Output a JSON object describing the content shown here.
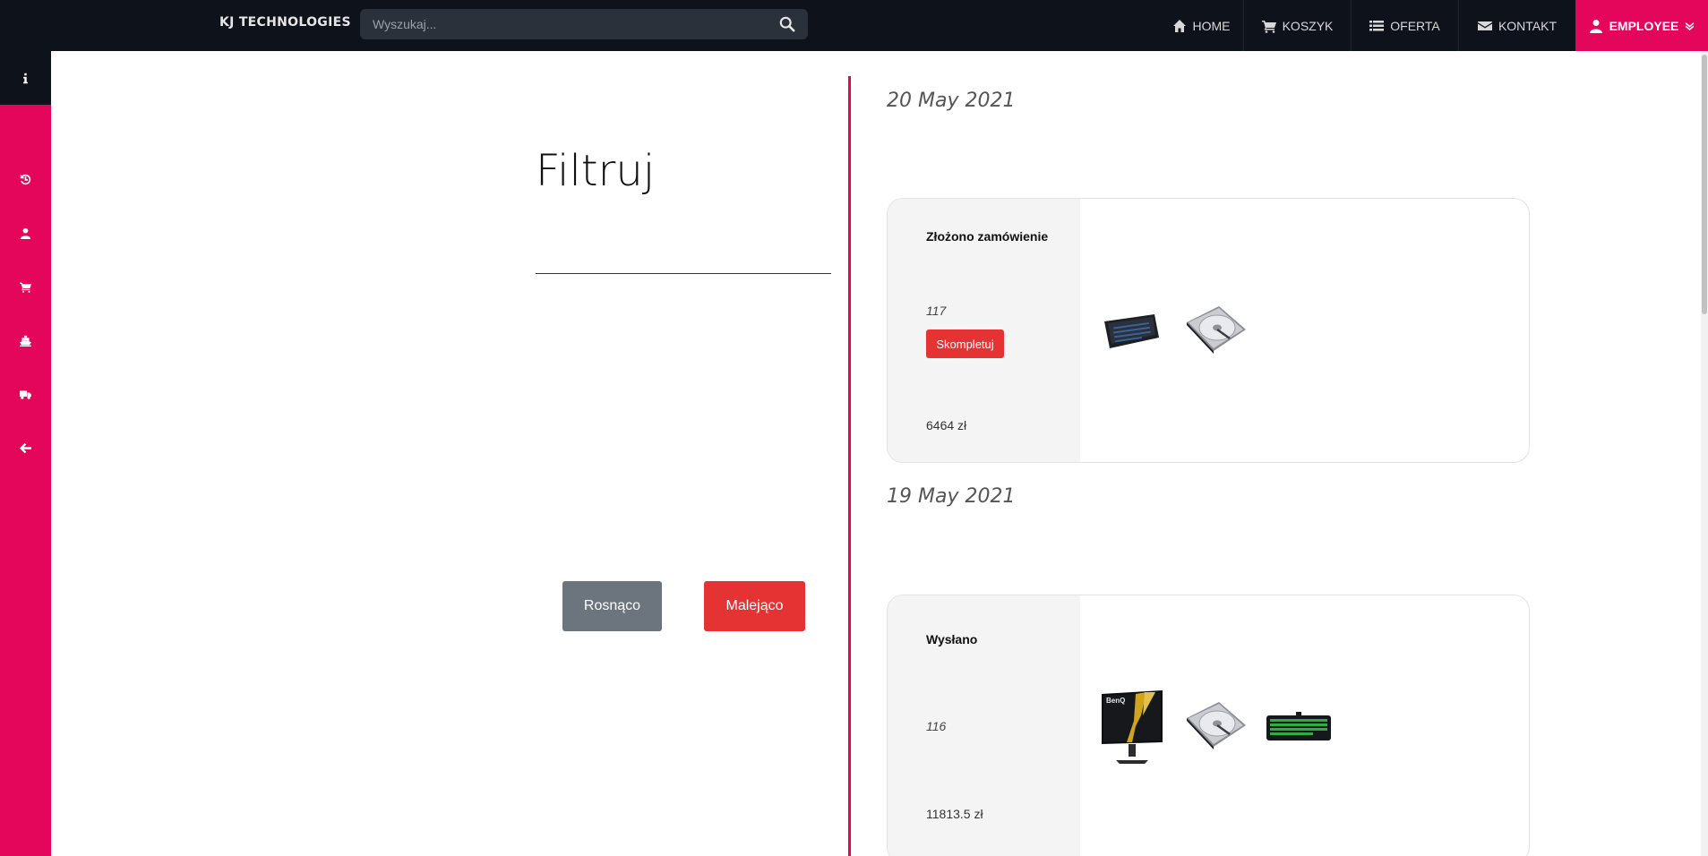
{
  "header": {
    "brand": "KJ TECHNOLOGIES",
    "search_placeholder": "Wyszukaj...",
    "nav": [
      {
        "label": "HOME",
        "icon": "home-icon"
      },
      {
        "label": "KOSZYK",
        "icon": "cart-icon"
      },
      {
        "label": "OFERTA",
        "icon": "list-icon"
      },
      {
        "label": "KONTAKT",
        "icon": "envelope-icon"
      }
    ],
    "user": {
      "label": "EMPLOYEE",
      "icon": "user-icon"
    }
  },
  "sidebar": {
    "items": [
      {
        "icon": "info-icon"
      },
      {
        "icon": "history-icon"
      },
      {
        "icon": "user-icon"
      },
      {
        "icon": "cart-icon"
      },
      {
        "icon": "ship-icon"
      },
      {
        "icon": "truck-icon"
      },
      {
        "icon": "arrow-left-icon"
      }
    ]
  },
  "filter": {
    "title": "Filtruj",
    "input_value": "",
    "asc_label": "Rosnąco",
    "desc_label": "Malejąco"
  },
  "orders": [
    {
      "date": "20 May 2021",
      "status": "Złożono zamówienie",
      "id": "117",
      "action_label": "Skompletuj",
      "price": "6464 zł",
      "products": [
        "keyboard",
        "hard-drive"
      ]
    },
    {
      "date": "19 May 2021",
      "status": "Wysłano",
      "id": "116",
      "price": "11813.5 zł",
      "products": [
        "monitor",
        "hard-drive",
        "keyboard"
      ],
      "monitor_brand": "BenQ"
    }
  ],
  "colors": {
    "accent": "#e3065a",
    "nav_bg": "#0e131b",
    "danger": "#e53333",
    "secondary": "#6c757d"
  }
}
